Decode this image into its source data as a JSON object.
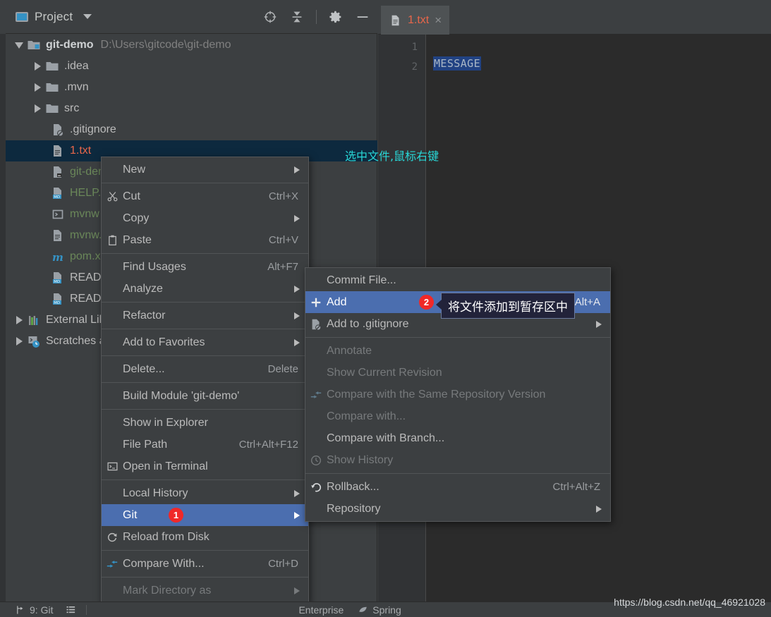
{
  "app": {
    "theme_bg": "#3c3f41",
    "accent_selection": "#4b6eaf",
    "tree_selection": "#0d293e",
    "badge_color": "#f02828",
    "annotation_color": "#28d7d7"
  },
  "project_panel": {
    "title": "Project",
    "icons": {
      "project": "project-icon",
      "dropdown": "chevron-down-icon",
      "locate": "locate-target-icon",
      "collapse": "collapse-all-icon",
      "settings": "gear-icon",
      "hide": "minimize-icon"
    },
    "tree": [
      {
        "label": "git-demo",
        "path": "D:\\Users\\gitcode\\git-demo",
        "depth": 0,
        "expanded": true,
        "arrow": "down",
        "icon": "module-folder-icon",
        "style": "bold"
      },
      {
        "label": ".idea",
        "path": "",
        "depth": 1,
        "expanded": false,
        "arrow": "right",
        "icon": "folder-icon",
        "style": "normal"
      },
      {
        "label": ".mvn",
        "path": "",
        "depth": 1,
        "expanded": false,
        "arrow": "right",
        "icon": "folder-icon",
        "style": "normal"
      },
      {
        "label": "src",
        "path": "",
        "depth": 1,
        "expanded": false,
        "arrow": "right",
        "icon": "folder-icon",
        "style": "normal"
      },
      {
        "label": ".gitignore",
        "path": "",
        "depth": 2,
        "expanded": false,
        "arrow": "none",
        "icon": "gitignore-file-icon",
        "style": "normal"
      },
      {
        "label": "1.txt",
        "path": "",
        "depth": 2,
        "expanded": false,
        "arrow": "none",
        "icon": "text-file-icon",
        "style": "orange",
        "selected": true
      },
      {
        "label": "git-demo.iml",
        "path": "",
        "depth": 2,
        "expanded": false,
        "arrow": "none",
        "icon": "iml-file-icon",
        "style": "green"
      },
      {
        "label": "HELP.md",
        "path": "",
        "depth": 2,
        "expanded": false,
        "arrow": "none",
        "icon": "markdown-file-icon",
        "style": "green"
      },
      {
        "label": "mvnw",
        "path": "",
        "depth": 2,
        "expanded": false,
        "arrow": "none",
        "icon": "shell-file-icon",
        "style": "green"
      },
      {
        "label": "mvnw.cmd",
        "path": "",
        "depth": 2,
        "expanded": false,
        "arrow": "none",
        "icon": "text-file-icon",
        "style": "green"
      },
      {
        "label": "pom.xml",
        "path": "",
        "depth": 2,
        "expanded": false,
        "arrow": "none",
        "icon": "maven-file-icon",
        "style": "green"
      },
      {
        "label": "README.md",
        "path": "",
        "depth": 2,
        "expanded": false,
        "arrow": "none",
        "icon": "markdown-file-icon",
        "style": "normal"
      },
      {
        "label": "README.en.md",
        "path": "",
        "depth": 2,
        "expanded": false,
        "arrow": "none",
        "icon": "markdown-file-icon",
        "style": "normal"
      },
      {
        "label": "External Libraries",
        "path": "",
        "depth": 0,
        "expanded": false,
        "arrow": "right",
        "icon": "libraries-icon",
        "style": "normal"
      },
      {
        "label": "Scratches and Consoles",
        "path": "",
        "depth": 0,
        "expanded": false,
        "arrow": "right",
        "icon": "scratches-icon",
        "style": "normal"
      }
    ]
  },
  "editor": {
    "tab": {
      "label": "1.txt",
      "icon": "text-file-icon",
      "close": "×"
    },
    "line_numbers": [
      "1",
      "2"
    ],
    "lines": [
      {
        "number": "1",
        "text": "",
        "selected": false
      },
      {
        "number": "2",
        "text": "MESSAGE",
        "selected": true
      }
    ]
  },
  "annotation": {
    "text": "选中文件,鼠标右键"
  },
  "context_menu": {
    "items": [
      {
        "label": "New",
        "accel": "",
        "icon": "",
        "submenu": true,
        "sep_after": true
      },
      {
        "label": "Cut",
        "accel": "Ctrl+X",
        "icon": "scissors-icon",
        "submenu": false,
        "mnemonic": "t"
      },
      {
        "label": "Copy",
        "accel": "",
        "icon": "",
        "submenu": true
      },
      {
        "label": "Paste",
        "accel": "Ctrl+V",
        "icon": "clipboard-icon",
        "submenu": false,
        "mnemonic": "P",
        "sep_after": true
      },
      {
        "label": "Find Usages",
        "accel": "Alt+F7",
        "icon": "",
        "submenu": false,
        "mnemonic": "U"
      },
      {
        "label": "Analyze",
        "accel": "",
        "icon": "",
        "submenu": true,
        "mnemonic": "z",
        "sep_after": true
      },
      {
        "label": "Refactor",
        "accel": "",
        "icon": "",
        "submenu": true,
        "mnemonic": "R",
        "sep_after": true
      },
      {
        "label": "Add to Favorites",
        "accel": "",
        "icon": "",
        "submenu": true,
        "mnemonic": "a",
        "sep_after": true
      },
      {
        "label": "Delete...",
        "accel": "Delete",
        "icon": "",
        "submenu": false,
        "mnemonic": "D",
        "sep_after": true
      },
      {
        "label": "Build Module 'git-demo'",
        "accel": "",
        "icon": "",
        "submenu": false,
        "mnemonic": "M",
        "sep_after": true
      },
      {
        "label": "Show in Explorer",
        "accel": "",
        "icon": "",
        "submenu": false
      },
      {
        "label": "File Path",
        "accel": "Ctrl+Alt+F12",
        "icon": "",
        "submenu": false,
        "mnemonic": "P"
      },
      {
        "label": "Open in Terminal",
        "accel": "",
        "icon": "terminal-icon",
        "submenu": false,
        "sep_after": true
      },
      {
        "label": "Local History",
        "accel": "",
        "icon": "",
        "submenu": true,
        "mnemonic": "H"
      },
      {
        "label": "Git",
        "accel": "",
        "icon": "",
        "submenu": true,
        "mnemonic": "G",
        "highlighted": true,
        "badge": "1"
      },
      {
        "label": "Reload from Disk",
        "accel": "",
        "icon": "refresh-icon",
        "submenu": false,
        "sep_after": true
      },
      {
        "label": "Compare With...",
        "accel": "Ctrl+D",
        "icon": "compare-icon",
        "submenu": false,
        "sep_after": true
      },
      {
        "label": "Mark Directory as",
        "accel": "",
        "icon": "",
        "submenu": true,
        "disabled": true
      }
    ]
  },
  "git_submenu": {
    "items": [
      {
        "label": "Commit File...",
        "accel": "",
        "icon": "",
        "submenu": false,
        "mnemonic": "i"
      },
      {
        "label": "Add",
        "accel": "Ctrl+Alt+A",
        "icon": "plus-icon",
        "submenu": false,
        "highlighted": true,
        "badge": "2"
      },
      {
        "label": "Add to .gitignore",
        "accel": "",
        "icon": "gitignore-file-icon",
        "submenu": true,
        "sep_after": true
      },
      {
        "label": "Annotate",
        "accel": "",
        "icon": "",
        "submenu": false,
        "disabled": true,
        "mnemonic": "n"
      },
      {
        "label": "Show Current Revision",
        "accel": "",
        "icon": "",
        "submenu": false,
        "disabled": true
      },
      {
        "label": "Compare with the Same Repository Version",
        "accel": "",
        "icon": "compare-icon",
        "submenu": false,
        "disabled": true,
        "mnemonic": "y"
      },
      {
        "label": "Compare with...",
        "accel": "",
        "icon": "",
        "submenu": false,
        "disabled": true,
        "mnemonic": "C"
      },
      {
        "label": "Compare with Branch...",
        "accel": "",
        "icon": "",
        "submenu": false
      },
      {
        "label": "Show History",
        "accel": "",
        "icon": "clock-icon",
        "submenu": false,
        "disabled": true,
        "mnemonic": "H",
        "sep_after": true
      },
      {
        "label": "Rollback...",
        "accel": "Ctrl+Alt+Z",
        "icon": "rollback-icon",
        "submenu": false,
        "mnemonic": "R"
      },
      {
        "label": "Repository",
        "accel": "",
        "icon": "",
        "submenu": true,
        "mnemonic": "R"
      }
    ]
  },
  "tooltip": {
    "text": "将文件添加到暂存区中"
  },
  "status_bar": {
    "git_label": "9: Git",
    "git_icon": "git-branch-icon",
    "todo_icon": "list-icon",
    "enterprise_label": "Enterprise",
    "spring_label": "Spring",
    "spring_icon": "spring-leaf-icon",
    "watermark": "https://blog.csdn.net/qq_46921028"
  }
}
